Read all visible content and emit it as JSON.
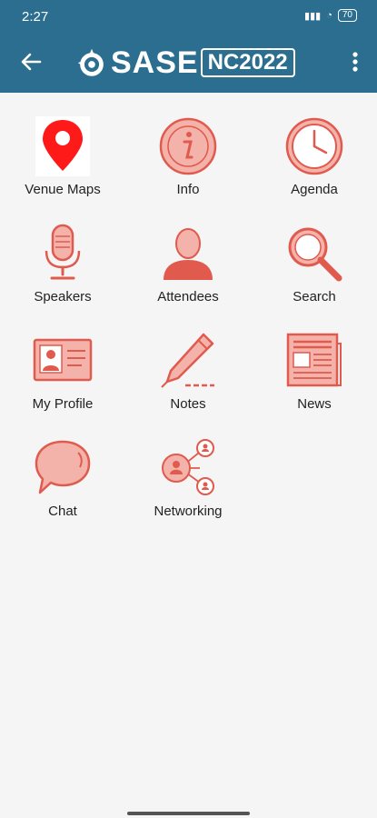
{
  "status": {
    "time": "2:27",
    "battery": "70"
  },
  "header": {
    "logo_main": "SASE",
    "logo_sub": "NC2022"
  },
  "tiles": [
    {
      "label": "Venue Maps",
      "icon": "map-pin-icon"
    },
    {
      "label": "Info",
      "icon": "info-icon"
    },
    {
      "label": "Agenda",
      "icon": "clock-icon"
    },
    {
      "label": "Speakers",
      "icon": "microphone-icon"
    },
    {
      "label": "Attendees",
      "icon": "person-icon"
    },
    {
      "label": "Search",
      "icon": "magnifier-icon"
    },
    {
      "label": "My Profile",
      "icon": "id-card-icon"
    },
    {
      "label": "Notes",
      "icon": "pen-icon"
    },
    {
      "label": "News",
      "icon": "newspaper-icon"
    },
    {
      "label": "Chat",
      "icon": "chat-bubble-icon"
    },
    {
      "label": "Networking",
      "icon": "network-icon"
    }
  ],
  "colors": {
    "header": "#2c6e8f",
    "icon_red": "#e05a4e",
    "pin_red": "#ff1a1a"
  }
}
